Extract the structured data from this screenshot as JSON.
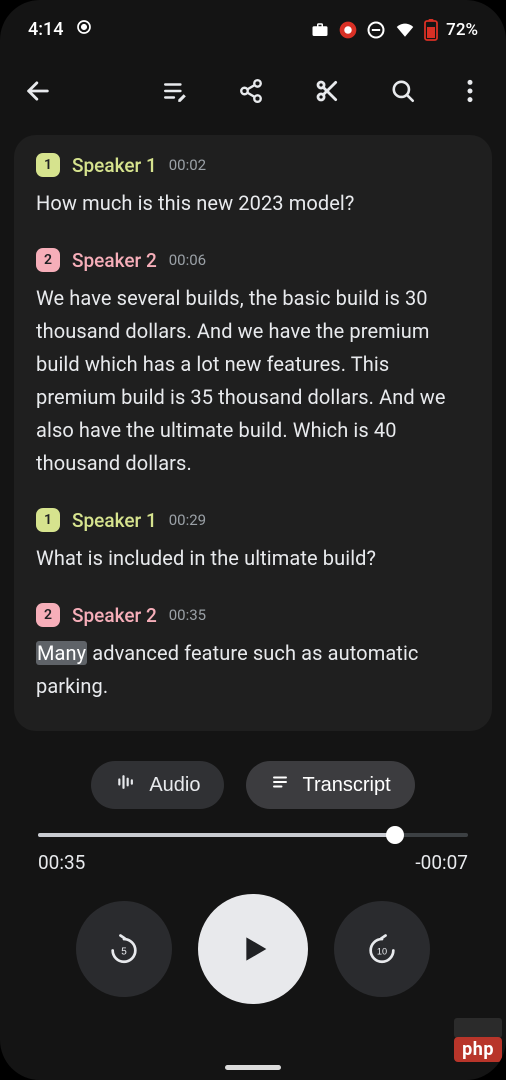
{
  "status": {
    "time": "4:14",
    "battery_pct": "72%"
  },
  "speakers": {
    "1": {
      "label": "Speaker 1",
      "badge": "1",
      "color": "#d6e38e"
    },
    "2": {
      "label": "Speaker 2",
      "badge": "2",
      "color": "#f6aeb9"
    }
  },
  "transcript": [
    {
      "speaker": "1",
      "time": "00:02",
      "text": "How much is this new 2023 model?"
    },
    {
      "speaker": "2",
      "time": "00:06",
      "text": "We have several builds, the basic build is 30 thousand dollars. And we have the premium build which has a lot new features. This premium build is 35 thousand dollars. And we also have the ultimate build. Which is 40 thousand dollars."
    },
    {
      "speaker": "1",
      "time": "00:29",
      "text": "What is included in the ultimate build?"
    },
    {
      "speaker": "2",
      "time": "00:35",
      "highlight_word": "Many",
      "text_rest": " advanced feature such as automatic parking."
    }
  ],
  "view_toggle": {
    "audio": "Audio",
    "transcript": "Transcript",
    "active": "transcript"
  },
  "playback": {
    "elapsed": "00:35",
    "remaining": "-00:07",
    "progress_pct": 83,
    "rewind_seconds": "5",
    "forward_seconds": "10"
  },
  "watermark": "php"
}
